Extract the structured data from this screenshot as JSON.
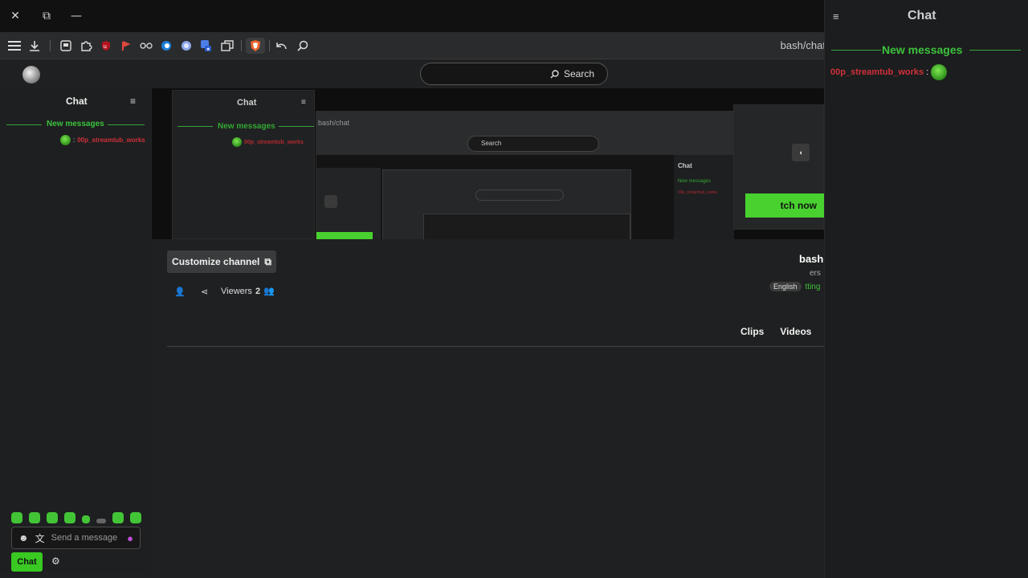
{
  "window": {
    "close_glyph": "✕",
    "restore_glyph": "⧉",
    "minimize_glyph": "—"
  },
  "toolbar": {
    "url": "bash/chat",
    "icons": [
      "menu-icon",
      "download-icon",
      "screenshot-icon",
      "extensions-icon",
      "ublock-icon",
      "flag-icon",
      "glasses-icon",
      "edge-icon",
      "circle-icon",
      "translate-icon",
      "tab-icon",
      "brave-shield-icon",
      "back-icon",
      "search-icon"
    ]
  },
  "header": {
    "search_label": "Search"
  },
  "left_chat": {
    "title": "Chat",
    "new_messages": "New messages",
    "message_user": "00p_streamtub_works",
    "message_sep": ":"
  },
  "stream_preview": {
    "nested_chat_title": "Chat",
    "nested_new_messages": "New messages",
    "nested_user": "00p_streamtub_works",
    "nested_url": "bash/chat",
    "nested_search": "Search",
    "nested_watch": "tch now",
    "nested_chat_small": "Chat",
    "nested_newmsg_small": "New messages",
    "nested_user_small": "00p_streamtub_works"
  },
  "channel": {
    "customize_label": "Customize channel",
    "viewers_count": "2",
    "viewers_label": "Viewers",
    "name": "bash",
    "sub": "ers",
    "category": "tting",
    "language_tag": "English"
  },
  "tabs": [
    "Videos",
    "Clips"
  ],
  "composer": {
    "placeholder": "Send a message",
    "chat_button": "Chat"
  },
  "right_chat": {
    "title": "Chat",
    "new_messages": "New messages",
    "message_user": "00p_streamtub_works",
    "message_sep": ":"
  },
  "colors": {
    "accent_green": "#3cc23c",
    "button_green": "#39c922",
    "username_red": "#d0313a"
  }
}
